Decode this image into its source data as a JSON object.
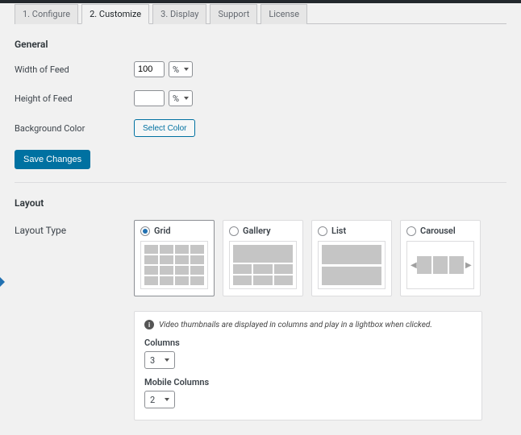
{
  "tabs": [
    {
      "label": "1. Configure",
      "active": false
    },
    {
      "label": "2. Customize",
      "active": true
    },
    {
      "label": "3. Display",
      "active": false
    },
    {
      "label": "Support",
      "active": false
    },
    {
      "label": "License",
      "active": false
    }
  ],
  "general": {
    "title": "General",
    "width_label": "Width of Feed",
    "width_value": "100",
    "width_unit": "%",
    "height_label": "Height of Feed",
    "height_value": "",
    "height_unit": "%",
    "bgcolor_label": "Background Color",
    "bgcolor_button": "Select Color",
    "save_button": "Save Changes"
  },
  "layout": {
    "title": "Layout",
    "type_label": "Layout Type",
    "options": [
      {
        "key": "grid",
        "label": "Grid",
        "selected": true
      },
      {
        "key": "gallery",
        "label": "Gallery",
        "selected": false
      },
      {
        "key": "list",
        "label": "List",
        "selected": false
      },
      {
        "key": "carousel",
        "label": "Carousel",
        "selected": false
      }
    ],
    "info_text": "Video thumbnails are displayed in columns and play in a lightbox when clicked.",
    "columns_label": "Columns",
    "columns_value": "3",
    "mobile_columns_label": "Mobile Columns",
    "mobile_columns_value": "2"
  }
}
